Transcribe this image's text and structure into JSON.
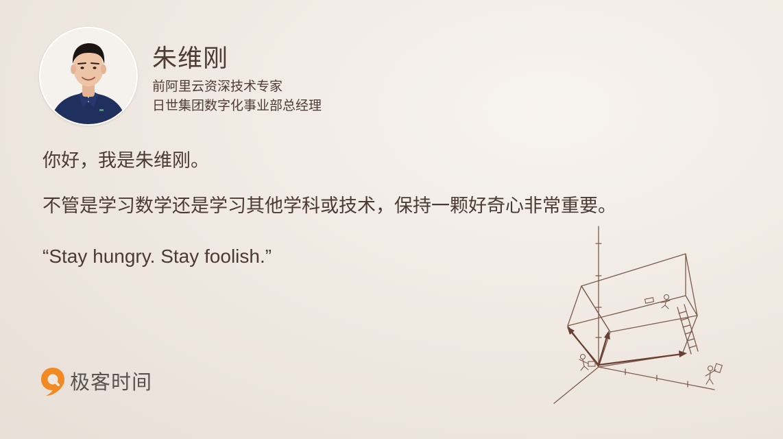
{
  "author": {
    "name": "朱维刚",
    "titles": [
      "前阿里云资深技术专家",
      "日世集团数字化事业部总经理"
    ]
  },
  "content": {
    "greeting": "你好，我是朱维刚。",
    "message": "不管是学习数学还是学习其他学科或技术，保持一颗好奇心非常重要。",
    "quote": "“Stay hungry. Stay foolish.”"
  },
  "brand": {
    "name": "极客时间",
    "accent_color": "#f28a24"
  },
  "icons": {
    "logo": "geektime-logo-icon",
    "illustration": "vector-box-sketch-illustration"
  },
  "colors": {
    "text": "#4a3a33",
    "background": "#efe8e1",
    "sketch": "#7a5a4c"
  }
}
